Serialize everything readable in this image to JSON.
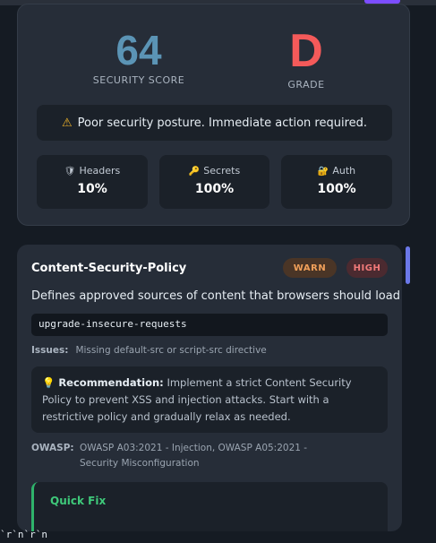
{
  "score": {
    "value": "64",
    "label": "SECURITY SCORE",
    "grade": "D",
    "grade_label": "GRADE",
    "warning": "Poor security posture. Immediate action required.",
    "stats": [
      {
        "icon": "shield-icon",
        "glyph": "🛡",
        "title": "Headers",
        "value": "10%"
      },
      {
        "icon": "key-icon",
        "glyph": "🔑",
        "title": "Secrets",
        "value": "100%"
      },
      {
        "icon": "lock-icon",
        "glyph": "🔐",
        "title": "Auth",
        "value": "100%"
      }
    ]
  },
  "policy": {
    "title": "Content-Security-Policy",
    "badges": [
      "WARN",
      "HIGH"
    ],
    "description": "Defines approved sources of content that browsers should load",
    "value": "upgrade-insecure-requests",
    "issues_label": "Issues:",
    "issues_text": "Missing default-src or script-src directive",
    "recommendation_label": "Recommendation:",
    "recommendation_text": "Implement a strict Content Security Policy to prevent XSS and injection attacks. Start with a restrictive policy and gradually relax as needed.",
    "owasp_label": "OWASP:",
    "owasp_text": "OWASP A03:2021 - Injection, OWASP A05:2021 - Security Misconfiguration",
    "quick_fix_title": "Quick Fix"
  },
  "colors": {
    "score": "#5b94b5",
    "grade": "#f45a5a",
    "warn": "#f0a05a",
    "high": "#f27a7a",
    "quick_fix": "#3fc97a",
    "scrollbar": "#6b78e8"
  },
  "footer_text": "`r`n`r`n"
}
